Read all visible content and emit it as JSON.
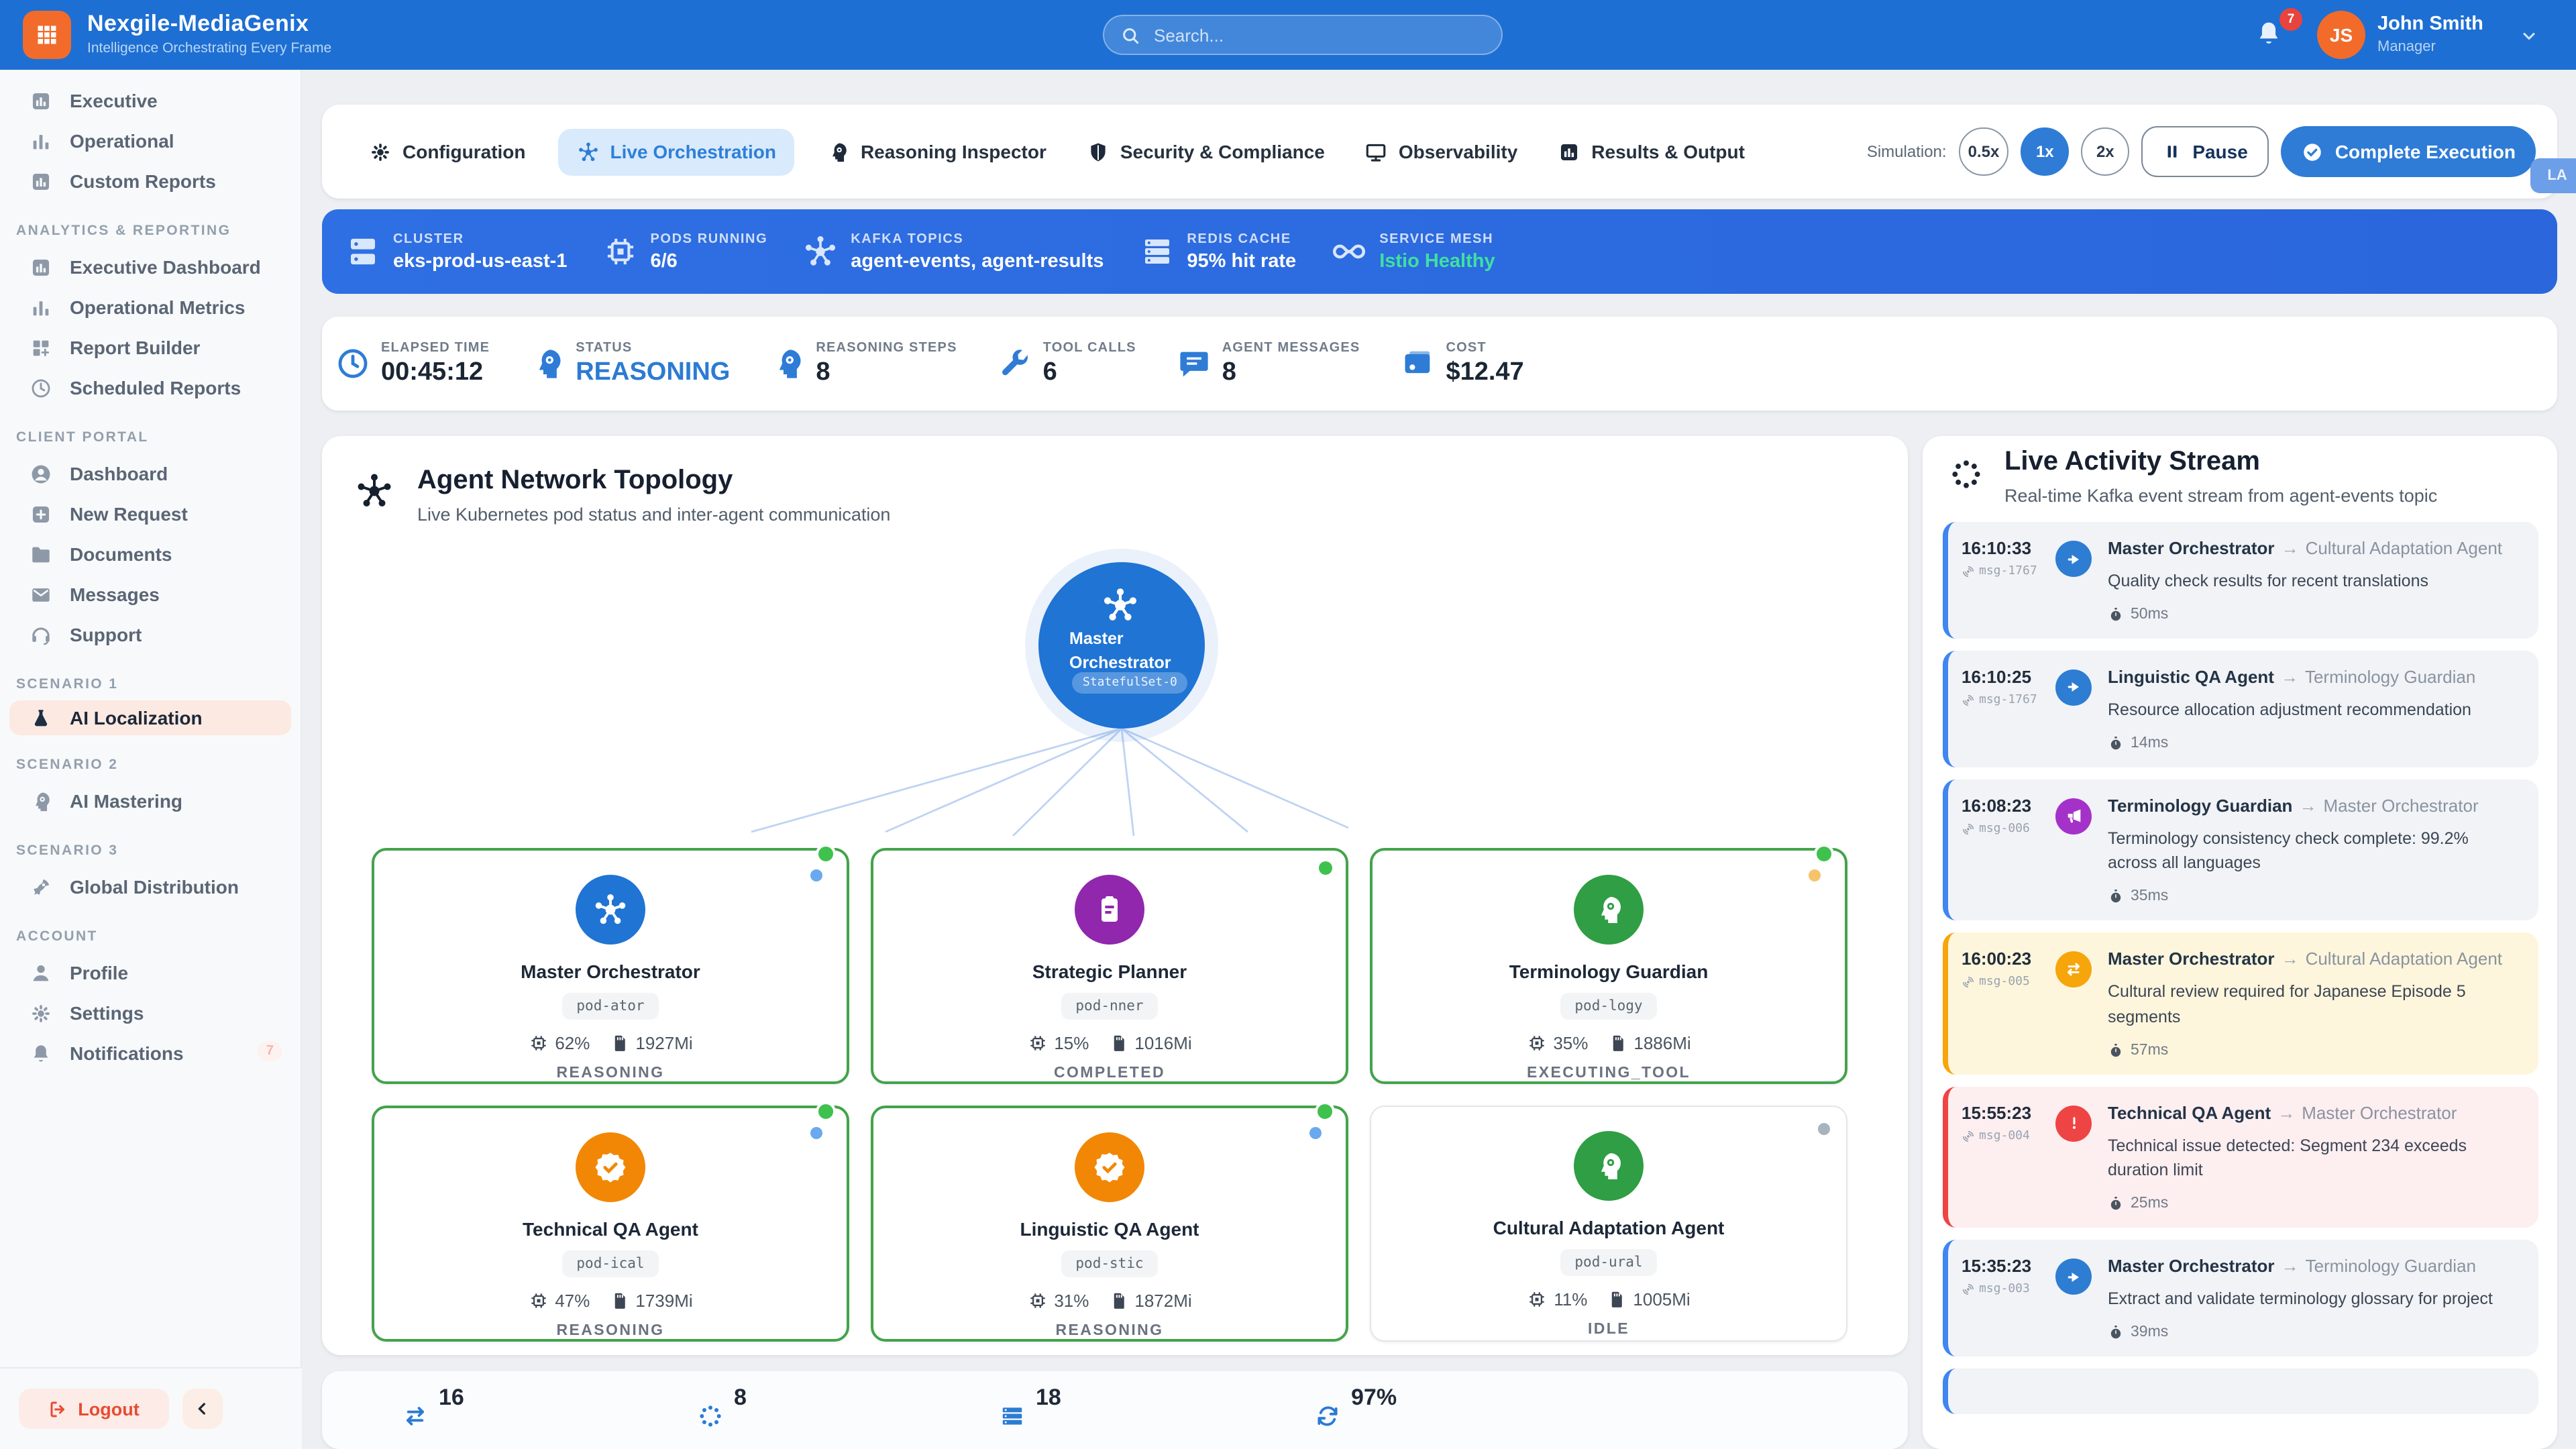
{
  "header": {
    "app_title": "Nexgile-MediaGenix",
    "app_subtitle": "Intelligence Orchestrating Every Frame",
    "search_placeholder": "Search...",
    "notification_count": "7",
    "user_initials": "JS",
    "user_name": "John Smith",
    "user_role": "Manager"
  },
  "sidebar": {
    "top_items": [
      {
        "label": "Executive"
      },
      {
        "label": "Operational"
      },
      {
        "label": "Custom Reports"
      }
    ],
    "sections": [
      {
        "title": "ANALYTICS & REPORTING",
        "items": [
          {
            "label": "Executive Dashboard"
          },
          {
            "label": "Operational Metrics"
          },
          {
            "label": "Report Builder"
          },
          {
            "label": "Scheduled Reports"
          }
        ]
      },
      {
        "title": "CLIENT PORTAL",
        "items": [
          {
            "label": "Dashboard"
          },
          {
            "label": "New Request"
          },
          {
            "label": "Documents"
          },
          {
            "label": "Messages"
          },
          {
            "label": "Support"
          }
        ]
      },
      {
        "title": "SCENARIO 1",
        "items": [
          {
            "label": "AI Localization",
            "active": true
          }
        ]
      },
      {
        "title": "SCENARIO 2",
        "items": [
          {
            "label": "AI Mastering"
          }
        ]
      },
      {
        "title": "SCENARIO 3",
        "items": [
          {
            "label": "Global Distribution"
          }
        ]
      },
      {
        "title": "ACCOUNT",
        "items": [
          {
            "label": "Profile"
          },
          {
            "label": "Settings"
          },
          {
            "label": "Notifications",
            "badge": "7"
          }
        ]
      }
    ],
    "logout_label": "Logout"
  },
  "tabs": [
    {
      "label": "Configuration"
    },
    {
      "label": "Live Orchestration",
      "active": true
    },
    {
      "label": "Reasoning Inspector"
    },
    {
      "label": "Security & Compliance"
    },
    {
      "label": "Observability"
    },
    {
      "label": "Results & Output"
    }
  ],
  "simulation": {
    "label": "Simulation:",
    "speeds": [
      "0.5x",
      "1x",
      "2x"
    ],
    "active_speed": "1x",
    "pause_label": "Pause",
    "complete_label": "Complete Execution"
  },
  "cluster_bar": {
    "items": [
      {
        "label": "CLUSTER",
        "value": "eks-prod-us-east-1"
      },
      {
        "label": "PODS RUNNING",
        "value": "6/6"
      },
      {
        "label": "KAFKA TOPICS",
        "value": "agent-events, agent-results"
      },
      {
        "label": "REDIS CACHE",
        "value": "95% hit rate"
      },
      {
        "label": "SERVICE MESH",
        "value": "Istio Healthy",
        "value_color": "#3fe0a0"
      }
    ]
  },
  "metrics": {
    "items": [
      {
        "label": "ELAPSED TIME",
        "value": "00:45:12"
      },
      {
        "label": "STATUS",
        "value": "REASONING",
        "value_color": "#2b7bd3"
      },
      {
        "label": "REASONING STEPS",
        "value": "8"
      },
      {
        "label": "TOOL CALLS",
        "value": "6"
      },
      {
        "label": "AGENT MESSAGES",
        "value": "8"
      },
      {
        "label": "COST",
        "value": "$12.47"
      }
    ]
  },
  "topology": {
    "title": "Agent Network Topology",
    "subtitle": "Live Kubernetes pod status and inter-agent communication",
    "center_node": {
      "name": "Master Orchestrator",
      "badge": "StatefulSet-0",
      "color": "#1f74d4"
    },
    "agents": [
      {
        "name": "Master Orchestrator",
        "pod": "pod-ator",
        "cpu": "62%",
        "memory": "1927Mi",
        "status": "REASONING",
        "color": "#1f74d4"
      },
      {
        "name": "Strategic Planner",
        "pod": "pod-nner",
        "cpu": "15%",
        "memory": "1016Mi",
        "status": "COMPLETED",
        "color": "#9027ad"
      },
      {
        "name": "Terminology Guardian",
        "pod": "pod-logy",
        "cpu": "35%",
        "memory": "1886Mi",
        "status": "EXECUTING_TOOL",
        "color": "#2f9e44"
      },
      {
        "name": "Technical QA Agent",
        "pod": "pod-ical",
        "cpu": "47%",
        "memory": "1739Mi",
        "status": "REASONING",
        "color": "#f28705"
      },
      {
        "name": "Linguistic QA Agent",
        "pod": "pod-stic",
        "cpu": "31%",
        "memory": "1872Mi",
        "status": "REASONING",
        "color": "#f28705"
      },
      {
        "name": "Cultural Adaptation Agent",
        "pod": "pod-ural",
        "cpu": "11%",
        "memory": "1005Mi",
        "status": "IDLE",
        "color": "#2f9e44"
      }
    ]
  },
  "activity": {
    "title": "Live Activity Stream",
    "subtitle": "Real-time Kafka event stream from agent-events topic",
    "events": [
      {
        "time": "16:10:33",
        "msg_id": "msg-1767",
        "from": "Master Orchestrator",
        "to": "Cultural Adaptation Agent",
        "message": "Quality check results for recent translations",
        "duration": "50ms",
        "type": "send"
      },
      {
        "time": "16:10:25",
        "msg_id": "msg-1767",
        "from": "Linguistic QA Agent",
        "to": "Terminology Guardian",
        "message": "Resource allocation adjustment recommendation",
        "duration": "14ms",
        "type": "send"
      },
      {
        "time": "16:08:23",
        "msg_id": "msg-006",
        "from": "Terminology Guardian",
        "to": "Master Orchestrator",
        "message": "Terminology consistency check complete: 99.2% across all languages",
        "duration": "35ms",
        "type": "broadcast"
      },
      {
        "time": "16:00:23",
        "msg_id": "msg-005",
        "from": "Master Orchestrator",
        "to": "Cultural Adaptation Agent",
        "message": "Cultural review required for Japanese Episode 5 segments",
        "duration": "57ms",
        "type": "request"
      },
      {
        "time": "15:55:23",
        "msg_id": "msg-004",
        "from": "Technical QA Agent",
        "to": "Master Orchestrator",
        "message": "Technical issue detected: Segment 234 exceeds duration limit",
        "duration": "25ms",
        "type": "error"
      },
      {
        "time": "15:35:23",
        "msg_id": "msg-003",
        "from": "Master Orchestrator",
        "to": "Terminology Guardian",
        "message": "Extract and validate terminology glossary for project",
        "duration": "39ms",
        "type": "send"
      }
    ]
  },
  "footer_stats": {
    "items": [
      {
        "value": "16"
      },
      {
        "value": "8"
      },
      {
        "value": "18"
      },
      {
        "value": "97%"
      }
    ]
  },
  "floating_badge": "LA"
}
